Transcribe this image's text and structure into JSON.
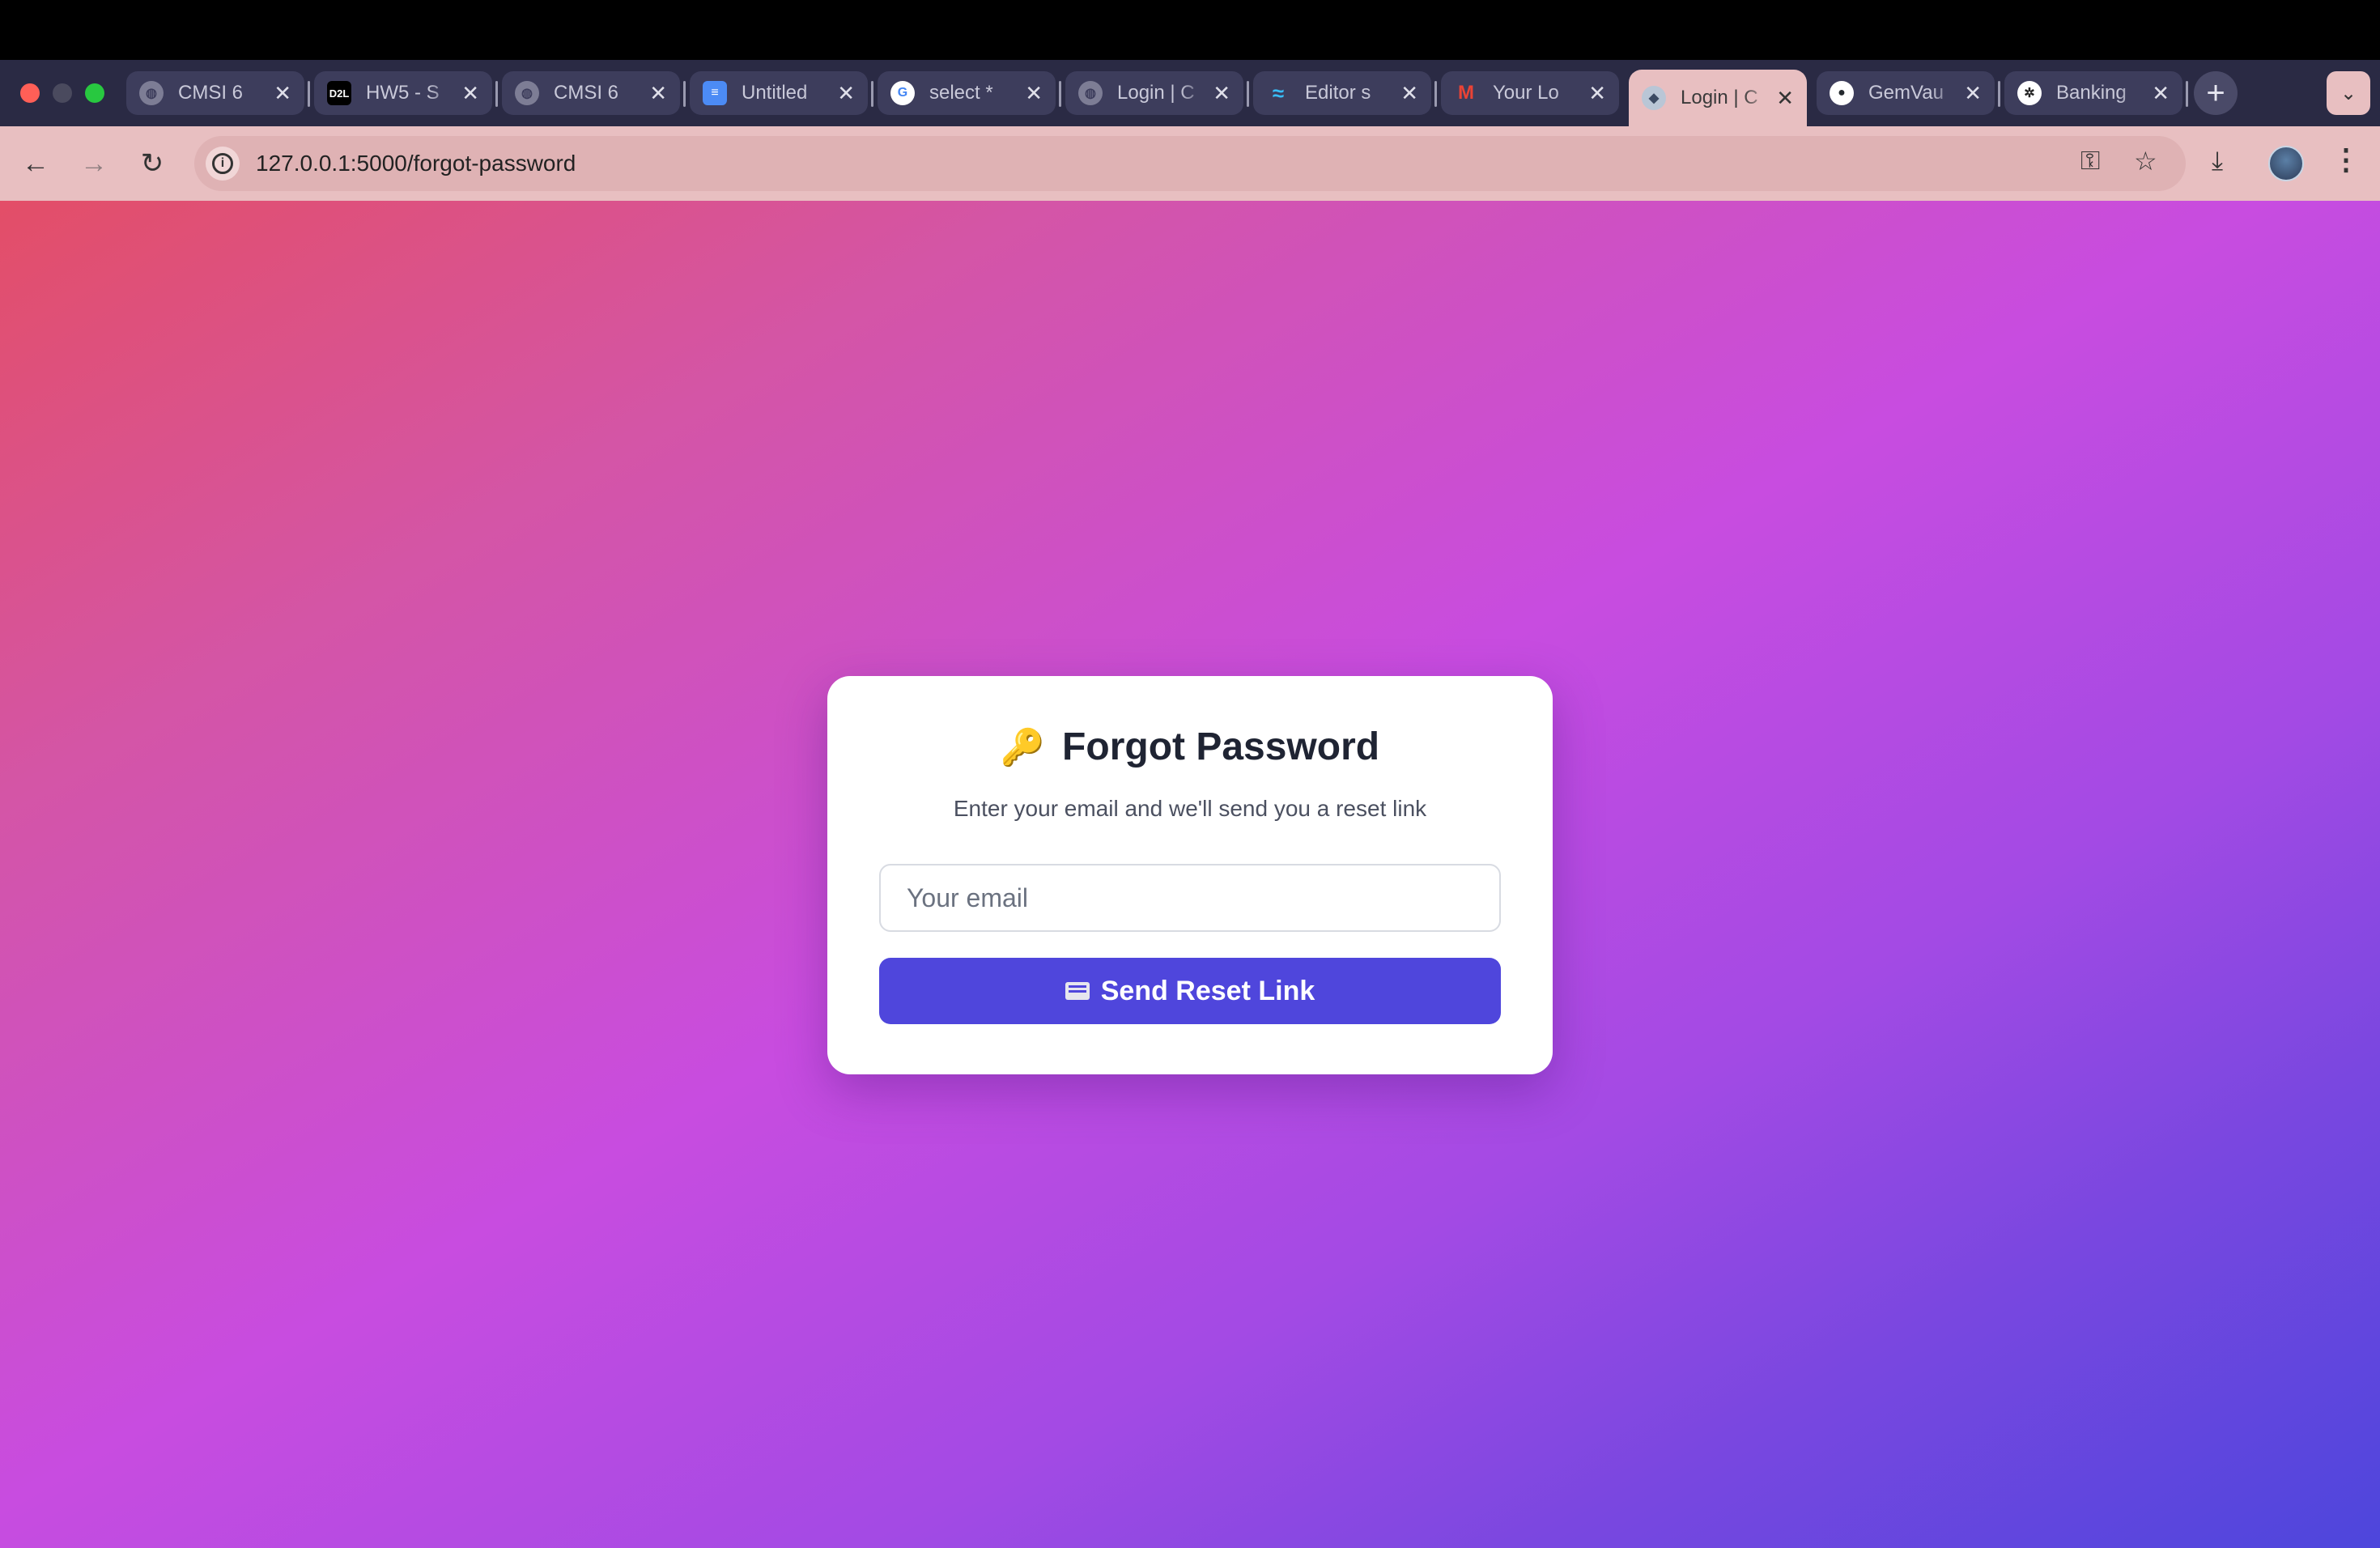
{
  "browser": {
    "tabs": [
      {
        "title": "CMSI 6",
        "favicon": "globe-icon",
        "active": false
      },
      {
        "title": "HW5 - S",
        "favicon": "d2l-icon",
        "active": false
      },
      {
        "title": "CMSI 6",
        "favicon": "globe-icon",
        "active": false
      },
      {
        "title": "Untitled",
        "favicon": "docs-icon",
        "active": false
      },
      {
        "title": "select *",
        "favicon": "google-icon",
        "active": false
      },
      {
        "title": "Login | C",
        "favicon": "globe-icon",
        "active": false
      },
      {
        "title": "Editor s",
        "favicon": "tailwind-icon",
        "active": false
      },
      {
        "title": "Your Lo",
        "favicon": "gmail-icon",
        "active": false
      },
      {
        "title": "Login | C",
        "favicon": "app-icon",
        "active": true
      },
      {
        "title": "GemVau",
        "favicon": "github-icon",
        "active": false
      },
      {
        "title": "Banking",
        "favicon": "openai-icon",
        "active": false
      }
    ],
    "close_glyph": "✕",
    "new_tab_glyph": "+",
    "url": "127.0.0.1:5000/forgot-password"
  },
  "page": {
    "title_icon": "🔑",
    "title": "Forgot Password",
    "subtitle": "Enter your email and we'll send you a reset link",
    "email_placeholder": "Your email",
    "email_value": "",
    "button_label": "Send Reset Link"
  },
  "colors": {
    "accent": "#4f46dc",
    "bg_gradient_start": "#e34e67",
    "bg_gradient_mid": "#c84ce0",
    "bg_gradient_end": "#4d46dc"
  }
}
